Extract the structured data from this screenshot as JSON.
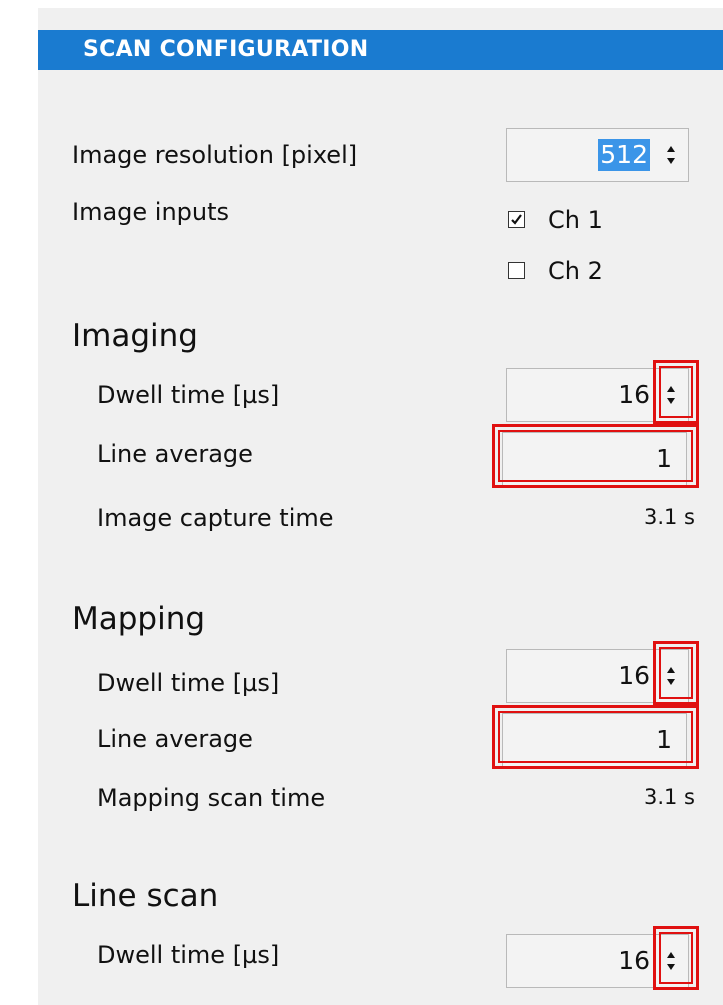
{
  "header": {
    "title": "SCAN CONFIGURATION"
  },
  "general": {
    "resolution_label": "Image resolution [pixel]",
    "resolution_value": "512",
    "inputs_label": "Image inputs",
    "channels": [
      {
        "label": "Ch 1",
        "checked": true
      },
      {
        "label": "Ch 2",
        "checked": false
      }
    ]
  },
  "imaging": {
    "title": "Imaging",
    "dwell_label": "Dwell time [µs]",
    "dwell_value": "16",
    "line_avg_label": "Line average",
    "line_avg_value": "1",
    "capture_label": "Image capture time",
    "capture_value": "3.1 s"
  },
  "mapping": {
    "title": "Mapping",
    "dwell_label": "Dwell time [µs]",
    "dwell_value": "16",
    "line_avg_label": "Line average",
    "line_avg_value": "1",
    "scan_time_label": "Mapping scan time",
    "scan_time_value": "3.1 s"
  },
  "line_scan": {
    "title": "Line scan",
    "dwell_label": "Dwell time [µs]",
    "dwell_value": "16"
  },
  "colors": {
    "header_bg": "#1a7bd0",
    "panel_bg": "#f0f0f0",
    "highlight": "#e01010",
    "selection": "#3b95e8"
  },
  "icons": [
    "checkbox-checked-icon",
    "checkbox-unchecked-icon",
    "spin-arrows-icon"
  ]
}
